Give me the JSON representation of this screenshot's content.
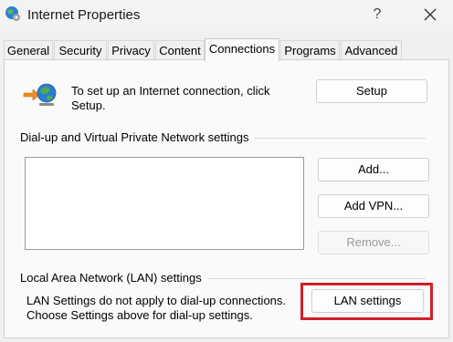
{
  "window": {
    "title": "Internet Properties",
    "help_label": "?",
    "icon": "globe-gear-icon",
    "close_icon": "close-icon"
  },
  "tabs": [
    {
      "label": "General",
      "active": false
    },
    {
      "label": "Security",
      "active": false
    },
    {
      "label": "Privacy",
      "active": false
    },
    {
      "label": "Content",
      "active": false
    },
    {
      "label": "Connections",
      "active": true
    },
    {
      "label": "Programs",
      "active": false
    },
    {
      "label": "Advanced",
      "active": false
    }
  ],
  "setup": {
    "text_line1": "To set up an Internet connection, click",
    "text_line2": "Setup.",
    "button_label": "Setup",
    "icon": "internet-connection-icon"
  },
  "vpn": {
    "section_label": "Dial-up and Virtual Private Network settings",
    "add_label": "Add...",
    "add_vpn_label": "Add VPN...",
    "remove_label": "Remove...",
    "remove_enabled": false
  },
  "lan": {
    "section_label": "Local Area Network (LAN) settings",
    "text_line1": "LAN Settings do not apply to dial-up connections.",
    "text_line2": "Choose Settings above for dial-up settings.",
    "button_label": "LAN settings",
    "highlight_color": "#d0202a"
  }
}
